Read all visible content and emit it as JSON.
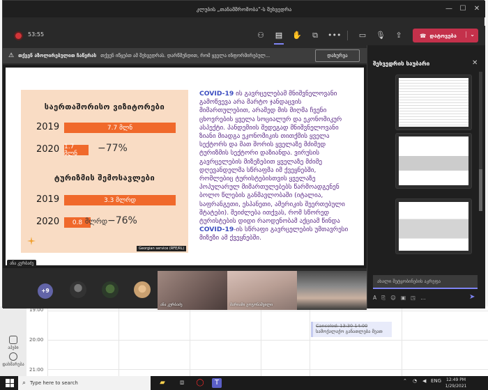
{
  "window": {
    "title": "კლუბის „თანამშრომობა“-ს შეხვედრა"
  },
  "toolbar": {
    "timer": "53:55",
    "leave_label": "დატოვება"
  },
  "notification": {
    "bold": "თქვენ აზოლირებულით ჩაწერას",
    "text": "თქვენ იწყებთ ამ შეხვედრას. დარწმუნდით, რომ ყველა ინფორმირებულ...",
    "dismiss": "დახურვა"
  },
  "slide": {
    "box_title": "საერთაშორისო ვიზიტორები",
    "tourism_title": "ტურიზმის შემოსავლები",
    "rows": [
      {
        "year": "2019",
        "bar_label": "7.7 მლნ",
        "fill": 1.0
      },
      {
        "year": "2020",
        "bar_label": "1.7 მლნ",
        "pct": "−77%",
        "fill": 0.22
      },
      {
        "year": "2019",
        "bar_label": "3.3 მლრდ",
        "fill": 1.0
      },
      {
        "year": "2020",
        "bar_label": "0.8",
        "unit": "მლრდ",
        "pct": "−76%",
        "fill": 0.24
      }
    ],
    "credit": "Georgian service (RFE/RL)",
    "text_lead": "COVID-19",
    "text_body": " ის გავრცელებამ მნიშვნელოვანი გამოწვევა არა მარტო ჯანდაცვის მიმართულებით, არამედ მის მიღმა ჩვენი ცხოვრების ყველა სოციალურ და ეკონომიკურ ასპექტი. პანდემიის შედეგად მნიშვნელოვანი ზიანი მიადგა ეკონომიკის თითქმის ყველა სექტორს და მათ შორის ყველაზე მძიმედ ტურიზმის სექტორი დაზიანდა. ვირუსის გავრცელების მიზეზებით ყველაზე მძიმე დღევანდელმა სწრაფმა იმ ქვეყნებში, რომლებიც ტურისტებისთვის ყველაზე პოპულარულ მიმართულებებს წარმოადგენენ ბოლო წლების განმავლობაში (იტალია, საფრანგეთი, ესპანეთი, ამერიკის შეერთებული შტატები). შეიძლება ითქვას, რომ სწორედ ტურისტების დიდი რაოდენობამ აქციამ წინდა ",
    "text_tail": "COVID-19",
    "text_end": "-ის სწრაფი გავრცელების უმთავრესი მიზეზი ამ ქვეყნებში."
  },
  "presenter_tag": "ანა კურბაძე",
  "participants": {
    "overflow": "+9",
    "videos": [
      {
        "name": "ანა კურბაძე"
      },
      {
        "name": "მარიამი გოგონაშვილი"
      },
      {
        "name": ""
      }
    ]
  },
  "chat": {
    "title": "შეხვედრის საუბარი",
    "placeholder": "ახალი შეტყობინების აკრეფა"
  },
  "calendar": {
    "times": [
      "19:00",
      "20:00",
      "21:00"
    ],
    "event_title": "Canceled: 13:30-14:00",
    "event_sub": "სამოქალაქო განათლება მეათ",
    "rail": [
      {
        "label": "აპები"
      },
      {
        "label": "დახმარება"
      }
    ]
  },
  "taskbar": {
    "search_placeholder": "Type here to search",
    "lang": "ENG",
    "time": "12:49 PM",
    "date": "1/29/2021"
  },
  "colors": {
    "leave": "#c4314b",
    "accent": "#6264a7",
    "bar": "#f0692b",
    "slide_text": "#5b2a86"
  }
}
